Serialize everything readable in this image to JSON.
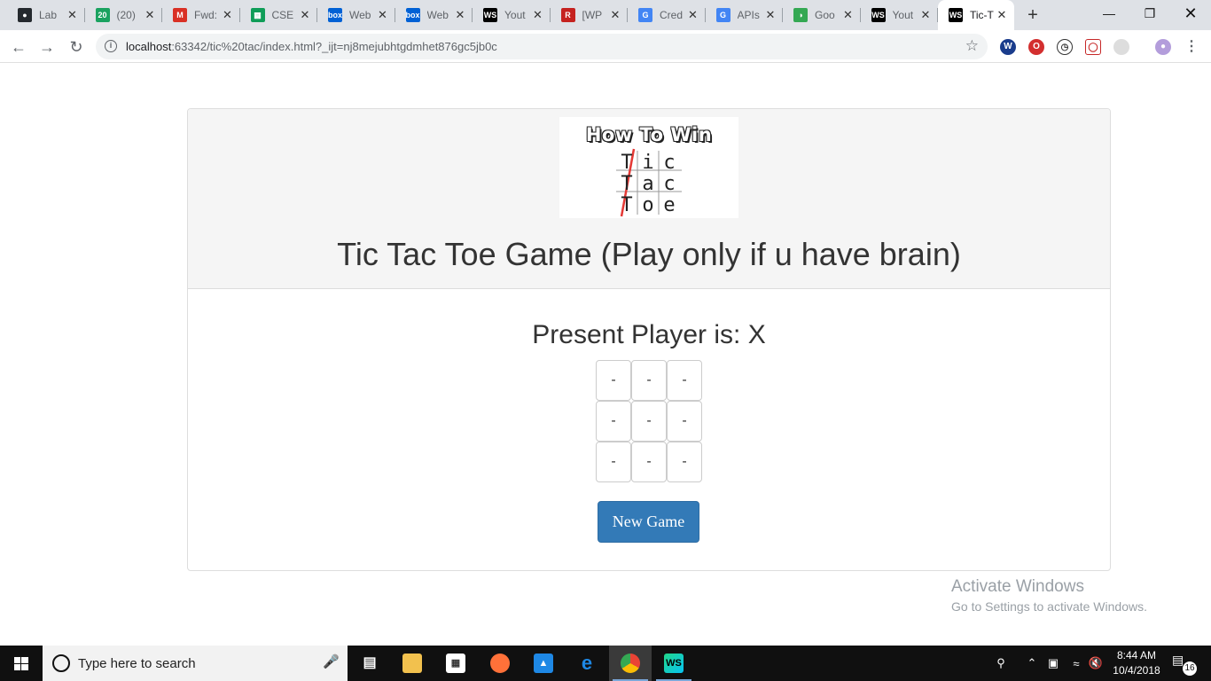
{
  "browser": {
    "tabs": [
      {
        "title": "Lab",
        "icon": "github-icon",
        "color": "#24292e",
        "glyph": "●"
      },
      {
        "title": "(20)",
        "icon": "twenty-badge-icon",
        "color": "#1aa260",
        "glyph": "20"
      },
      {
        "title": "Fwd:",
        "icon": "gmail-icon",
        "color": "#d93025",
        "glyph": "M"
      },
      {
        "title": "CSE",
        "icon": "sheets-icon",
        "color": "#0f9d58",
        "glyph": "▦"
      },
      {
        "title": "Web",
        "icon": "box-icon",
        "color": "#0061d5",
        "glyph": "box"
      },
      {
        "title": "Web",
        "icon": "box-icon",
        "color": "#0061d5",
        "glyph": "box"
      },
      {
        "title": "Yout",
        "icon": "webstorm-icon",
        "color": "#000000",
        "glyph": "WS"
      },
      {
        "title": "[WP",
        "icon": "r-icon",
        "color": "#c5221f",
        "glyph": "R"
      },
      {
        "title": "Cred",
        "icon": "google-icon",
        "color": "#4285f4",
        "glyph": "G"
      },
      {
        "title": "APIs",
        "icon": "google-icon",
        "color": "#4285f4",
        "glyph": "G"
      },
      {
        "title": "Goo",
        "icon": "google-dots-icon",
        "color": "#34a853",
        "glyph": "◑"
      },
      {
        "title": "Yout",
        "icon": "webstorm-icon",
        "color": "#000000",
        "glyph": "WS"
      },
      {
        "title": "Tic-T",
        "icon": "webstorm-icon",
        "color": "#000000",
        "glyph": "WS",
        "active": true
      }
    ],
    "new_tab": "+",
    "url_host": "localhost",
    "url_rest": ":63342/tic%20tac/index.html?_ijt=nj8mejubhtgdmhet876gc5jb0c"
  },
  "page": {
    "logo": {
      "title": "How To Win",
      "rows": [
        [
          "T",
          "i",
          "c"
        ],
        [
          "T",
          "a",
          "c"
        ],
        [
          "T",
          "o",
          "e"
        ]
      ]
    },
    "game_title": "Tic Tac Toe Game (Play only if u have brain)",
    "present_player_label": "Present Player is: X",
    "board": [
      "-",
      "-",
      "-",
      "-",
      "-",
      "-",
      "-",
      "-",
      "-"
    ],
    "new_game_button": "New Game"
  },
  "watermark": {
    "line1": "Activate Windows",
    "line2": "Go to Settings to activate Windows."
  },
  "taskbar": {
    "search_placeholder": "Type here to search",
    "time": "8:44 AM",
    "date": "10/4/2018",
    "notification_count": "16"
  }
}
